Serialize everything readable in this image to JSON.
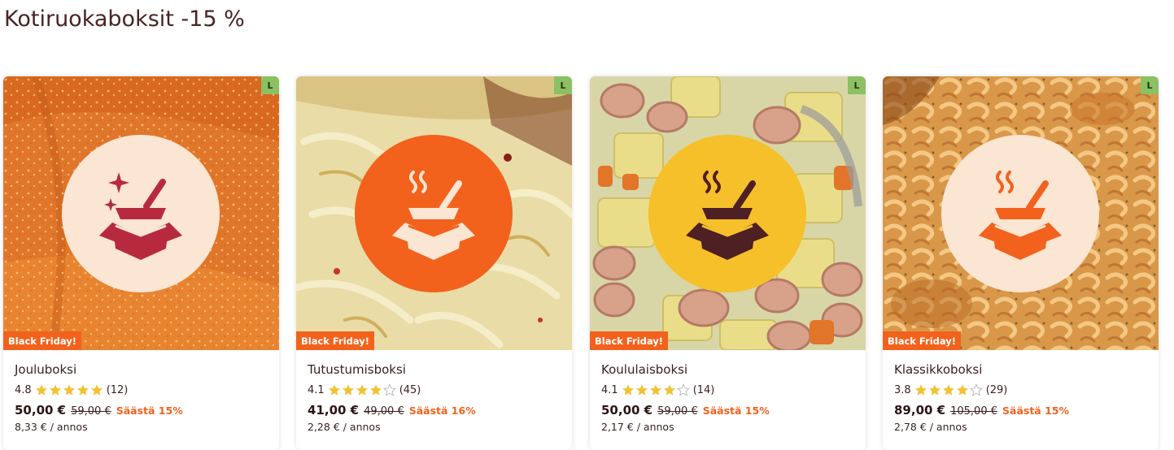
{
  "page": {
    "title": "Kotiruokaboksit -15 %"
  },
  "colors": {
    "brand_orange": "#f2621d",
    "diet_badge_green": "#8cc063",
    "star_gold": "#f1c232",
    "star_empty": "#cfcfcf",
    "logo_cream": "#fbe5d3",
    "logo_orange": "#f2621d",
    "logo_yellow": "#f5c02a",
    "logo_red": "#b72a3e",
    "logo_brown": "#4e1f23"
  },
  "products": [
    {
      "name": "Jouluboksi",
      "diet_badge": "L",
      "promo_badge": "Black Friday!",
      "rating": "4.8",
      "stars_filled": 5,
      "reviews": "(12)",
      "price": "50,00 €",
      "old_price": "59,00 €",
      "save": "Säästä 15%",
      "per_portion": "8,33 € / annos",
      "icon": "gift-box-sparkle-icon",
      "image": "fried-fish-photo"
    },
    {
      "name": "Tutustumisboksi",
      "diet_badge": "L",
      "promo_badge": "Black Friday!",
      "rating": "4.1",
      "stars_filled": 4,
      "reviews": "(45)",
      "price": "41,00 €",
      "old_price": "49,00 €",
      "save": "Säästä 16%",
      "per_portion": "2,28 € / annos",
      "icon": "food-box-steam-icon",
      "image": "cabbage-casserole-photo"
    },
    {
      "name": "Koululaisboksi",
      "diet_badge": "L",
      "promo_badge": "Black Friday!",
      "rating": "4.1",
      "stars_filled": 4,
      "reviews": "(14)",
      "price": "50,00 €",
      "old_price": "59,00 €",
      "save": "Säästä 15%",
      "per_portion": "2,17 € / annos",
      "icon": "food-box-steam-icon",
      "image": "sausage-soup-photo"
    },
    {
      "name": "Klassikkoboksi",
      "diet_badge": "L",
      "promo_badge": "Black Friday!",
      "rating": "3.8",
      "stars_filled": 4,
      "reviews": "(29)",
      "price": "89,00 €",
      "old_price": "105,00 €",
      "save": "Säästä 15%",
      "per_portion": "2,78 € / annos",
      "icon": "food-box-steam-icon",
      "image": "macaroni-casserole-photo"
    }
  ]
}
